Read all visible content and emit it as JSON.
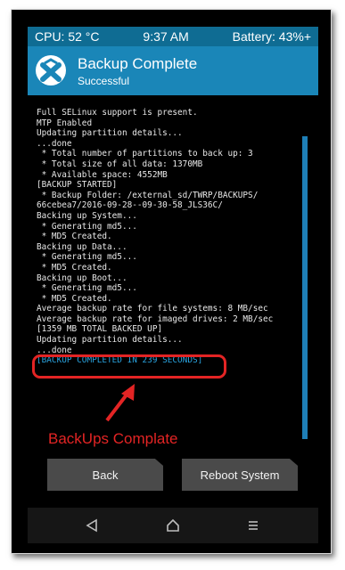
{
  "status": {
    "cpu": "CPU: 52 °C",
    "time": "9:37 AM",
    "battery": "Battery: 43%+"
  },
  "header": {
    "title": "Backup Complete",
    "subtitle": "Successful"
  },
  "log": {
    "lines": [
      "Full SELinux support is present.",
      "MTP Enabled",
      "Updating partition details...",
      "...done",
      " * Total number of partitions to back up: 3",
      " * Total size of all data: 1370MB",
      " * Available space: 4552MB",
      "[BACKUP STARTED]",
      " * Backup Folder: /external_sd/TWRP/BACKUPS/",
      "66cebea7/2016-09-28--09-30-58_JLS36C/",
      "Backing up System...",
      " * Generating md5...",
      " * MD5 Created.",
      "Backing up Data...",
      " * Generating md5...",
      " * MD5 Created.",
      "Backing up Boot...",
      " * Generating md5...",
      " * MD5 Created.",
      "Average backup rate for file systems: 8 MB/sec",
      "Average backup rate for imaged drives: 2 MB/sec",
      "[1359 MB TOTAL BACKED UP]",
      "Updating partition details...",
      "...done"
    ],
    "completed": "[BACKUP COMPLETED IN 239 SECONDS]"
  },
  "annotation": {
    "text": "BackUps Complate",
    "color": "#e32424"
  },
  "buttons": {
    "back": "Back",
    "reboot": "Reboot System"
  },
  "nav": {
    "icons": [
      "back-icon",
      "home-icon",
      "menu-icon"
    ]
  },
  "colors": {
    "statusbar": "#0f6c93",
    "header": "#1a86b8",
    "accent": "#2aa4e0"
  }
}
